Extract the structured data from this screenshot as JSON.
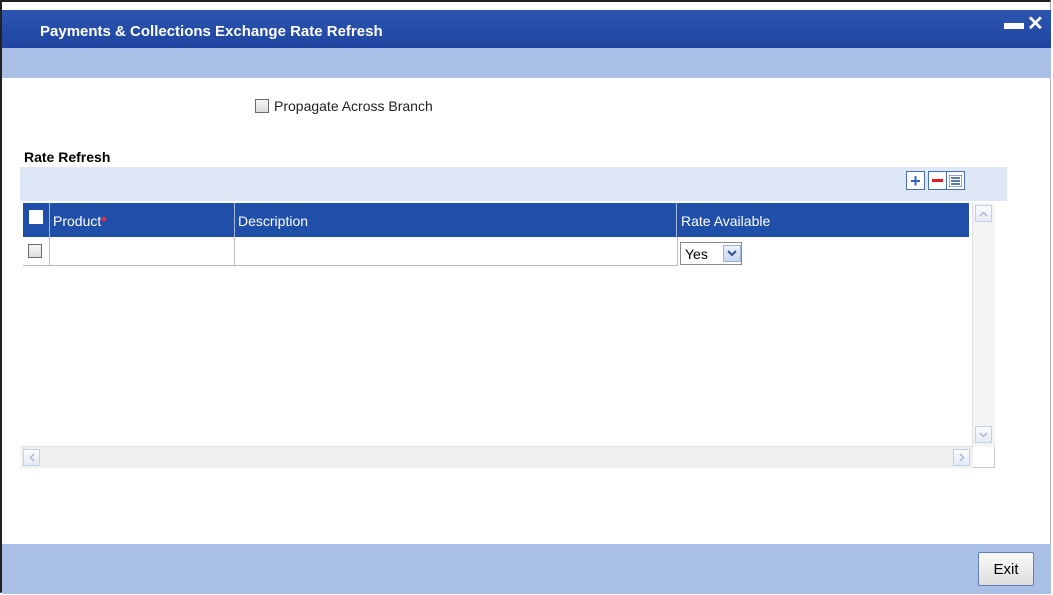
{
  "window": {
    "title": "Payments & Collections Exchange Rate Refresh",
    "minimize_icon": "minimize-icon",
    "close_icon": "close-icon"
  },
  "options": {
    "propagate_label": "Propagate Across Branch",
    "propagate_checked": false
  },
  "rate_refresh": {
    "section_title": "Rate Refresh",
    "toolbar": {
      "add_icon": "plus-icon",
      "delete_icon": "minus-icon",
      "view_icon": "list-icon"
    },
    "columns": [
      {
        "label": "Product",
        "required": true
      },
      {
        "label": "Description",
        "required": false
      },
      {
        "label": "Rate Available",
        "required": false
      }
    ],
    "required_marker": "*",
    "rows": [
      {
        "selected": false,
        "product": "",
        "description": "",
        "rate_available": "Yes"
      }
    ],
    "rate_options": [
      "Yes"
    ]
  },
  "footer": {
    "exit_label": "Exit"
  },
  "colors": {
    "titlebar": "#1f45a0",
    "subbar": "#a9bfe6",
    "grid_header": "#1f4fa8",
    "required": "#ff3030"
  }
}
